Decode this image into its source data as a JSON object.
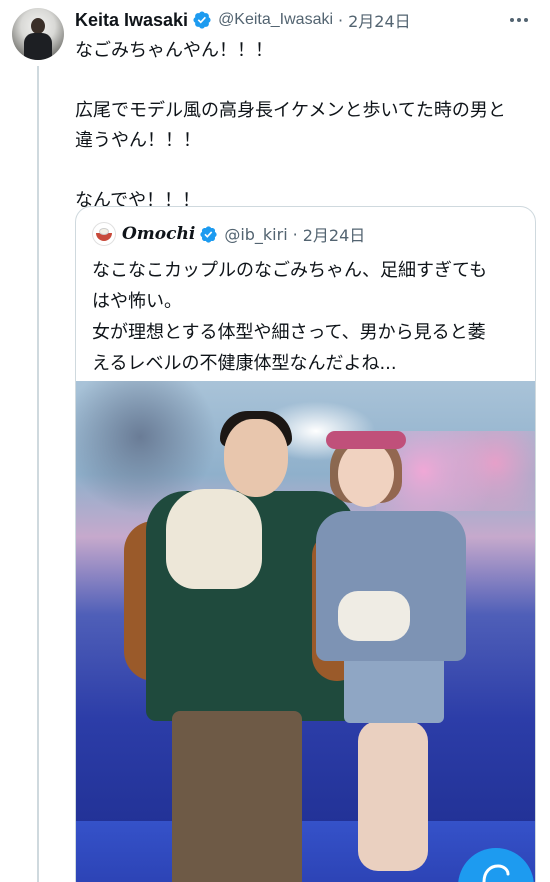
{
  "tweet": {
    "display_name": "Keita Iwasaki",
    "handle": "@Keita_Iwasaki",
    "separator": "·",
    "time": "2月24日",
    "lines": [
      "なごみちゃんやん！！！",
      "広尾でモデル風の高身長イケメンと歩いてた時の男と",
      "違うやん！！！",
      "なんでや！！！"
    ]
  },
  "quote": {
    "display_name": "Omochi",
    "handle": "@ib_kiri",
    "separator": "·",
    "time": "2月24日",
    "lines": [
      "なこなこカップルのなごみちゃん、足細すぎても",
      "はや怖い。",
      "女が理想とする体型や細さって、男から見ると萎",
      "えるレベルの不健康体型なんだよね..."
    ]
  },
  "colors": {
    "accent": "#1d9bf0",
    "text": "#0f1419",
    "secondary": "#536471",
    "border": "#cfd9de"
  },
  "icons": {
    "verified": "verified-badge-icon",
    "more": "more-options-icon",
    "fab": "compose-icon"
  }
}
